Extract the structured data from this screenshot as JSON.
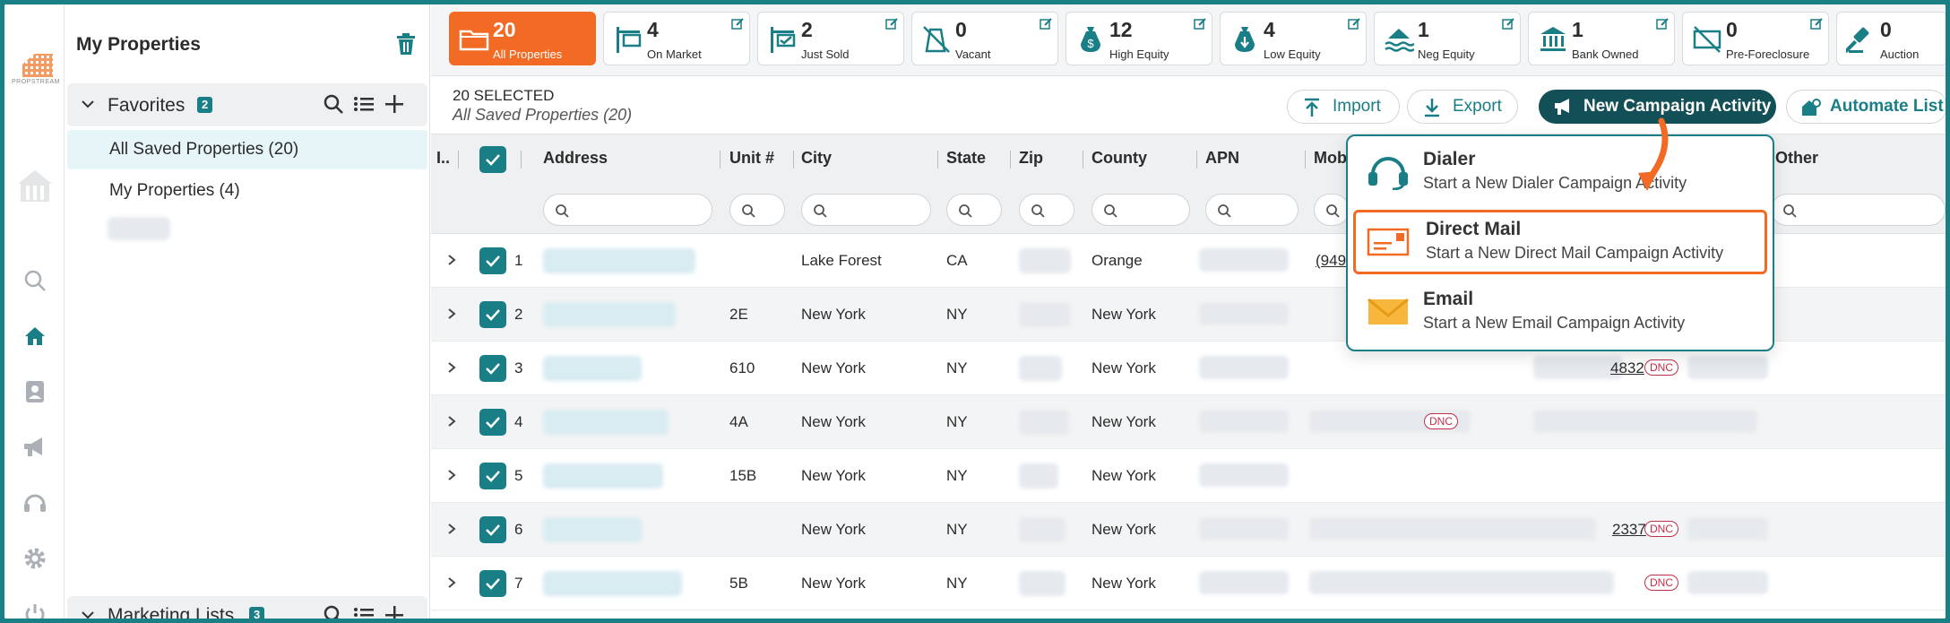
{
  "sidebar": {
    "title": "My Properties",
    "favorites": {
      "label": "Favorites",
      "count": "2",
      "items": [
        {
          "label": "All Saved Properties (20)"
        },
        {
          "label": "My Properties (4)"
        }
      ]
    },
    "marketing_lists": {
      "label": "Marketing Lists",
      "count": "3"
    }
  },
  "tiles": [
    {
      "count": "20",
      "label": "All Properties",
      "icon": "folder-icon"
    },
    {
      "count": "4",
      "label": "On Market",
      "icon": "sign-icon"
    },
    {
      "count": "2",
      "label": "Just Sold",
      "icon": "sold-sign-icon"
    },
    {
      "count": "0",
      "label": "Vacant",
      "icon": "vacant-icon"
    },
    {
      "count": "12",
      "label": "High Equity",
      "icon": "money-bag-up-icon"
    },
    {
      "count": "4",
      "label": "Low Equity",
      "icon": "money-bag-down-icon"
    },
    {
      "count": "1",
      "label": "Neg Equity",
      "icon": "flood-house-icon"
    },
    {
      "count": "1",
      "label": "Bank Owned",
      "icon": "bank-icon"
    },
    {
      "count": "0",
      "label": "Pre-Foreclosure",
      "icon": "pre-foreclosure-icon"
    },
    {
      "count": "0",
      "label": "Auction",
      "icon": "gavel-icon"
    }
  ],
  "selection": {
    "count_label": "20 SELECTED",
    "list_name": "All Saved Properties (20)"
  },
  "actions": {
    "import": "Import",
    "export": "Export",
    "new_campaign": "New Campaign Activity",
    "automate": "Automate List"
  },
  "table": {
    "columns": [
      "I..",
      "Address",
      "Unit #",
      "City",
      "State",
      "Zip",
      "County",
      "APN",
      "Mob",
      "Other"
    ],
    "rows": [
      {
        "n": "1",
        "unit": "",
        "city": "Lake Forest",
        "state": "CA",
        "county": "Orange"
      },
      {
        "n": "2",
        "unit": "2E",
        "city": "New York",
        "state": "NY",
        "county": "New York"
      },
      {
        "n": "3",
        "unit": "610",
        "city": "New York",
        "state": "NY",
        "county": "New York"
      },
      {
        "n": "4",
        "unit": "4A",
        "city": "New York",
        "state": "NY",
        "county": "New York"
      },
      {
        "n": "5",
        "unit": "15B",
        "city": "New York",
        "state": "NY",
        "county": "New York"
      },
      {
        "n": "6",
        "unit": "",
        "city": "New York",
        "state": "NY",
        "county": "New York"
      },
      {
        "n": "7",
        "unit": "5B",
        "city": "New York",
        "state": "NY",
        "county": "New York"
      }
    ],
    "phone_fragments": {
      "row1": "(949",
      "row3": "4832",
      "row6": "2337"
    },
    "dnc": "DNC"
  },
  "campaign_menu": [
    {
      "title": "Dialer",
      "subtitle": "Start a New Dialer Campaign Activity"
    },
    {
      "title": "Direct Mail",
      "subtitle": "Start a New Direct Mail Campaign Activity"
    },
    {
      "title": "Email",
      "subtitle": "Start a New Email Campaign Activity"
    }
  ],
  "colors": {
    "accent": "#1a7e86",
    "orange": "#f26a23",
    "dark_teal": "#124f56"
  }
}
